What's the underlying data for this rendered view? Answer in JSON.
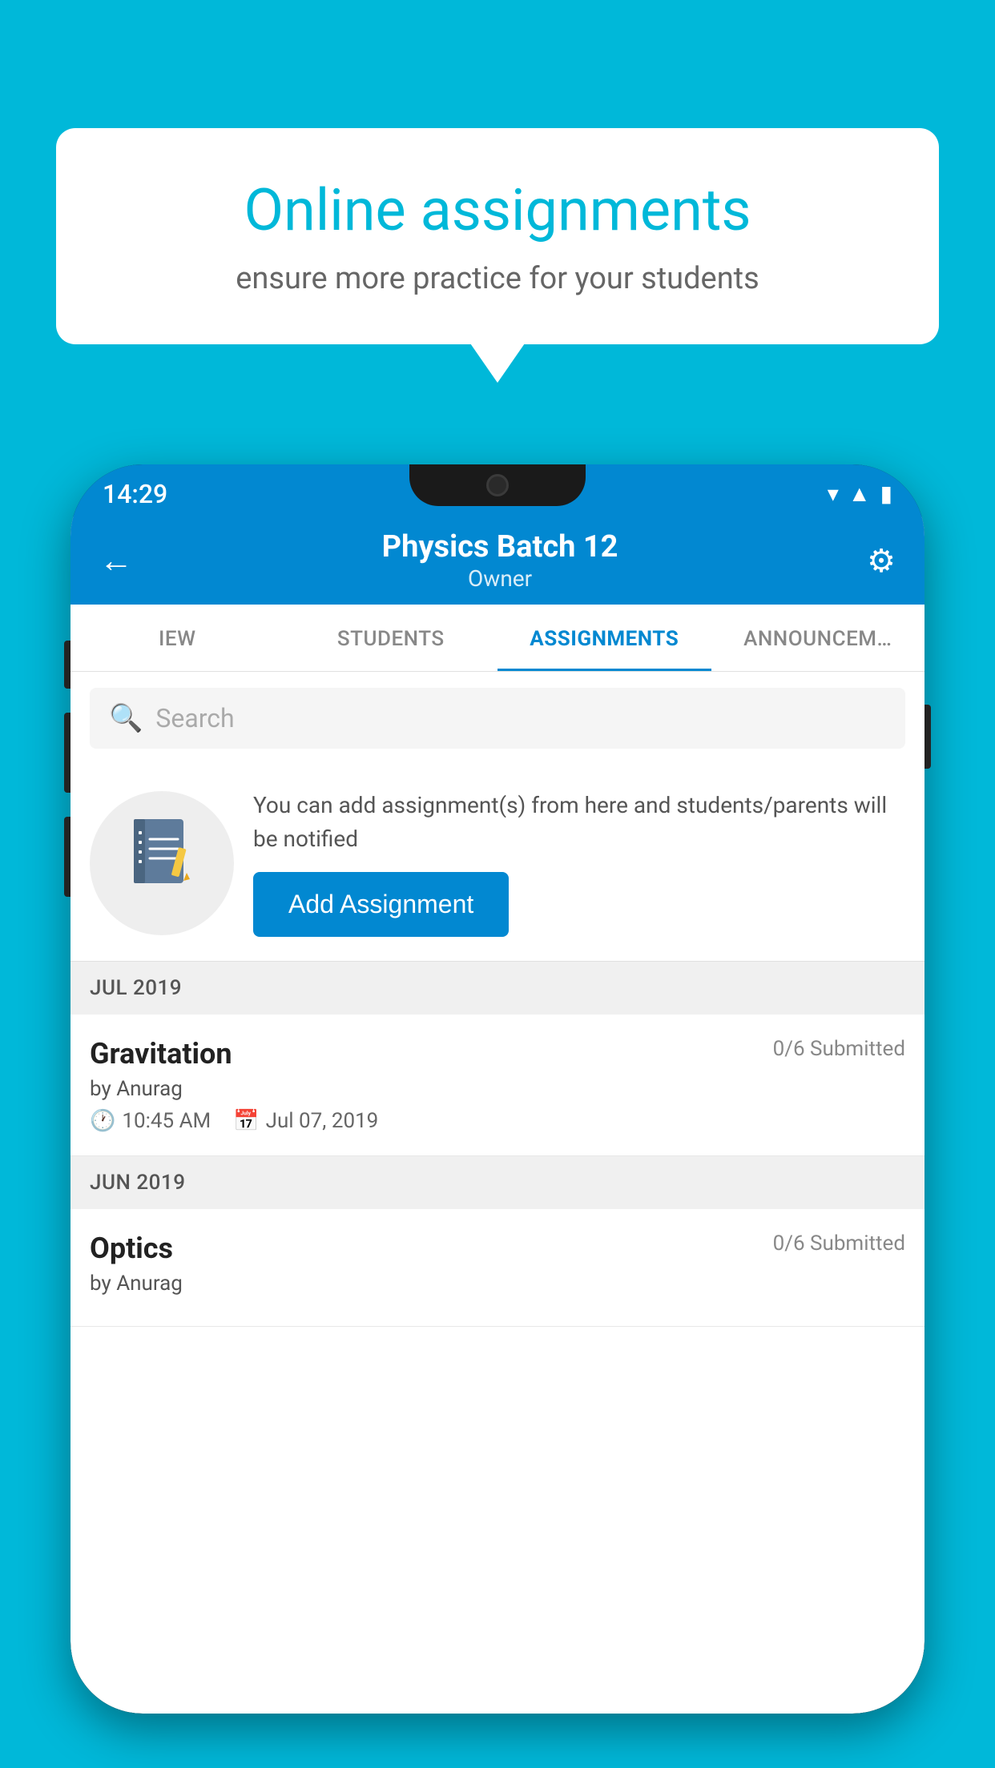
{
  "background": {
    "color": "#00B8D9"
  },
  "speech_bubble": {
    "title": "Online assignments",
    "subtitle": "ensure more practice for your students"
  },
  "phone": {
    "status_bar": {
      "time": "14:29",
      "icons": [
        "wifi",
        "signal",
        "battery"
      ]
    },
    "top_bar": {
      "title": "Physics Batch 12",
      "subtitle": "Owner",
      "back_label": "←",
      "settings_label": "⚙"
    },
    "tabs": [
      {
        "label": "IEW",
        "active": false
      },
      {
        "label": "STUDENTS",
        "active": false
      },
      {
        "label": "ASSIGNMENTS",
        "active": true
      },
      {
        "label": "ANNOUNCEM…",
        "active": false
      }
    ],
    "search": {
      "placeholder": "Search"
    },
    "promo": {
      "description": "You can add assignment(s) from here and students/parents will be notified",
      "add_button_label": "Add Assignment"
    },
    "sections": [
      {
        "header": "JUL 2019",
        "assignments": [
          {
            "name": "Gravitation",
            "submitted": "0/6 Submitted",
            "by": "by Anurag",
            "time": "10:45 AM",
            "date": "Jul 07, 2019"
          }
        ]
      },
      {
        "header": "JUN 2019",
        "assignments": [
          {
            "name": "Optics",
            "submitted": "0/6 Submitted",
            "by": "by Anurag",
            "time": "",
            "date": ""
          }
        ]
      }
    ]
  }
}
